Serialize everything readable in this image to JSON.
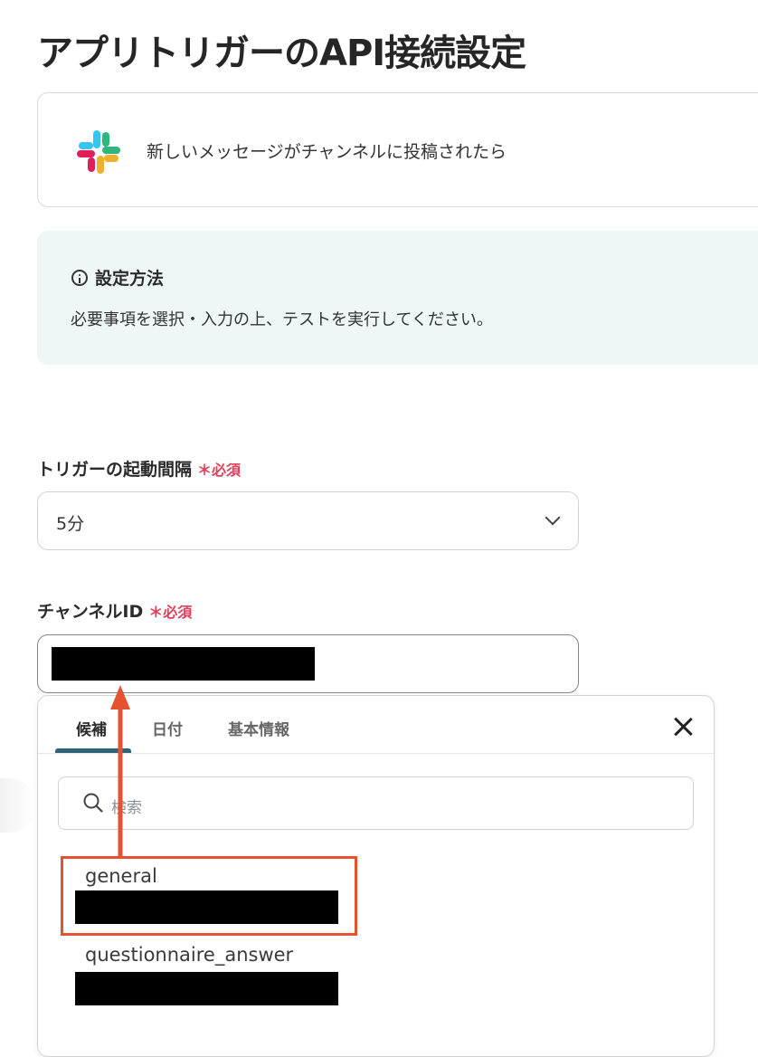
{
  "page": {
    "title": "アプリトリガーのAPI接続設定"
  },
  "trigger": {
    "app_icon": "slack-logo",
    "label": "新しいメッセージがチャンネルに投稿されたら"
  },
  "info": {
    "heading": "設定方法",
    "body": "必要事項を選択・入力の上、テストを実行してください。"
  },
  "fields": {
    "interval": {
      "label": "トリガーの起動間隔",
      "required_mark": "＊必須",
      "value": "5分"
    },
    "channel": {
      "label": "チャンネルID",
      "required_mark": "＊必須"
    }
  },
  "dropdown": {
    "tabs": [
      {
        "label": "候補"
      },
      {
        "label": "日付"
      },
      {
        "label": "基本情報"
      }
    ],
    "search_placeholder": "検索",
    "options": [
      {
        "name": "general"
      },
      {
        "name": "questionnaire_answer"
      }
    ]
  },
  "colors": {
    "highlight": "#e4522f",
    "required": "#e0405a",
    "tab_accent": "#2d6478",
    "info_bg": "#eef6f6"
  }
}
